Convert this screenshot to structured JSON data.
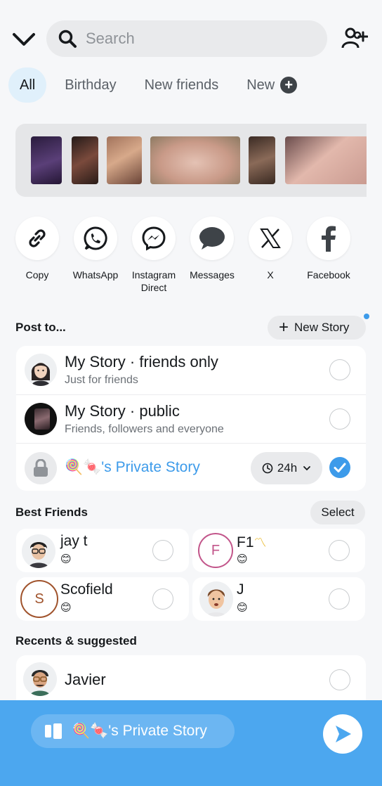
{
  "search": {
    "placeholder": "Search"
  },
  "filters": {
    "all": "All",
    "birthday": "Birthday",
    "new_friends": "New friends",
    "new": "New"
  },
  "share_apps": [
    {
      "label": "Copy",
      "icon": "link-icon"
    },
    {
      "label": "WhatsApp",
      "icon": "whatsapp-icon"
    },
    {
      "label": "Instagram\nDirect",
      "icon": "messenger-icon"
    },
    {
      "label": "Messages",
      "icon": "chat-bubble-icon"
    },
    {
      "label": "X",
      "icon": "x-logo-icon"
    },
    {
      "label": "Facebook",
      "icon": "facebook-icon"
    }
  ],
  "post_to": {
    "title": "Post to...",
    "new_story": "New Story",
    "rows": [
      {
        "title": "My Story · friends only",
        "subtitle": "Just for friends"
      },
      {
        "title": "My Story · public",
        "subtitle": "Friends, followers and everyone"
      }
    ],
    "private_story": {
      "emoji": "🍭🍬",
      "title": "'s Private Story",
      "timer": "24h"
    }
  },
  "best_friends": {
    "title": "Best Friends",
    "select": "Select",
    "friends": [
      {
        "name": "jay t",
        "emoji": "😊",
        "avatar": "bitmoji-avatar"
      },
      {
        "name": "F1",
        "name_emoji": "〽",
        "emoji": "😊",
        "initial": "F"
      },
      {
        "name": "Scofield",
        "emoji": "😊",
        "initial": "S"
      },
      {
        "name": "J",
        "emoji": "😊",
        "avatar": "bitmoji-avatar"
      }
    ]
  },
  "recents": {
    "title": "Recents & suggested",
    "items": [
      {
        "name": "Javier"
      }
    ]
  },
  "bottom": {
    "emoji": "🍭🍬",
    "label": "'s Private Story"
  },
  "colors": {
    "accent": "#3d9bea",
    "bottom_bar": "#4ca7ef",
    "f1_ring": "#c2558a",
    "scofield_ring": "#a0532c"
  }
}
